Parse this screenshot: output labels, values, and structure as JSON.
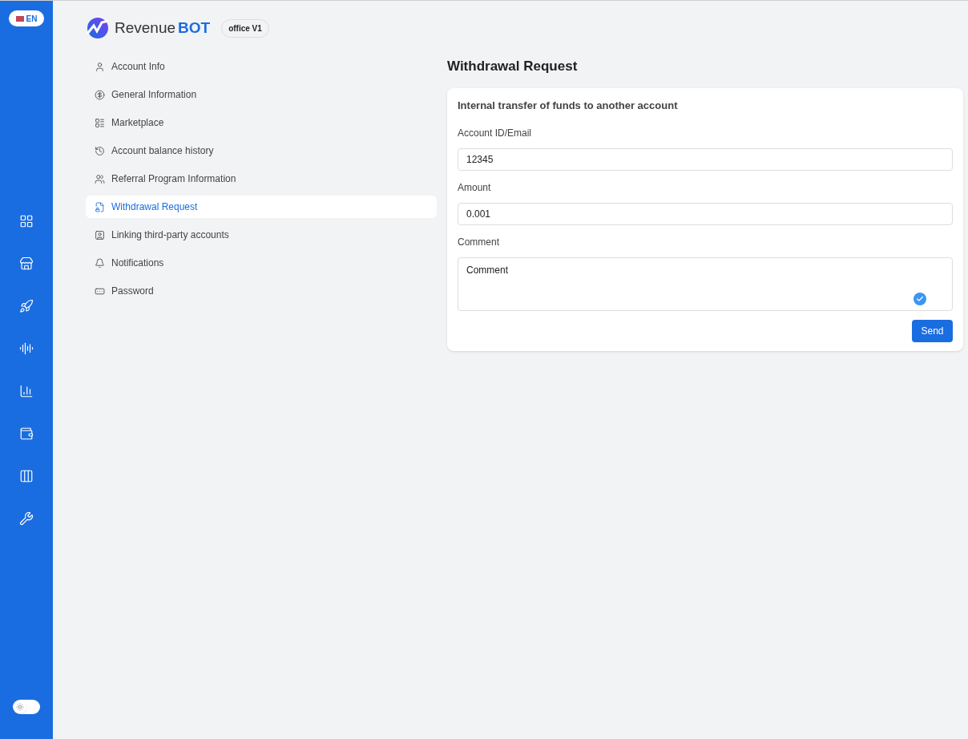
{
  "language": {
    "label": "EN"
  },
  "brand": {
    "name": "Revenue",
    "emphasis": "BOT",
    "badge": "office V1"
  },
  "nav": [
    {
      "label": "Account Info",
      "selected": false
    },
    {
      "label": "General Information",
      "selected": false
    },
    {
      "label": "Marketplace",
      "selected": false
    },
    {
      "label": "Account balance history",
      "selected": false
    },
    {
      "label": "Referral Program Information",
      "selected": false
    },
    {
      "label": "Withdrawal Request",
      "selected": true
    },
    {
      "label": "Linking third-party accounts",
      "selected": false
    },
    {
      "label": "Notifications",
      "selected": false
    },
    {
      "label": "Password",
      "selected": false
    }
  ],
  "page_title": "Withdrawal Request",
  "form": {
    "title": "Internal transfer of funds to another account",
    "fields": [
      {
        "kind": "input",
        "label": "Account ID/Email",
        "value": "12345"
      },
      {
        "kind": "input",
        "label": "Amount",
        "value": "0.001"
      },
      {
        "kind": "textarea",
        "label": "Comment",
        "value": "Comment"
      }
    ],
    "submit": "Send"
  },
  "theme_toggle": {
    "on": false
  }
}
